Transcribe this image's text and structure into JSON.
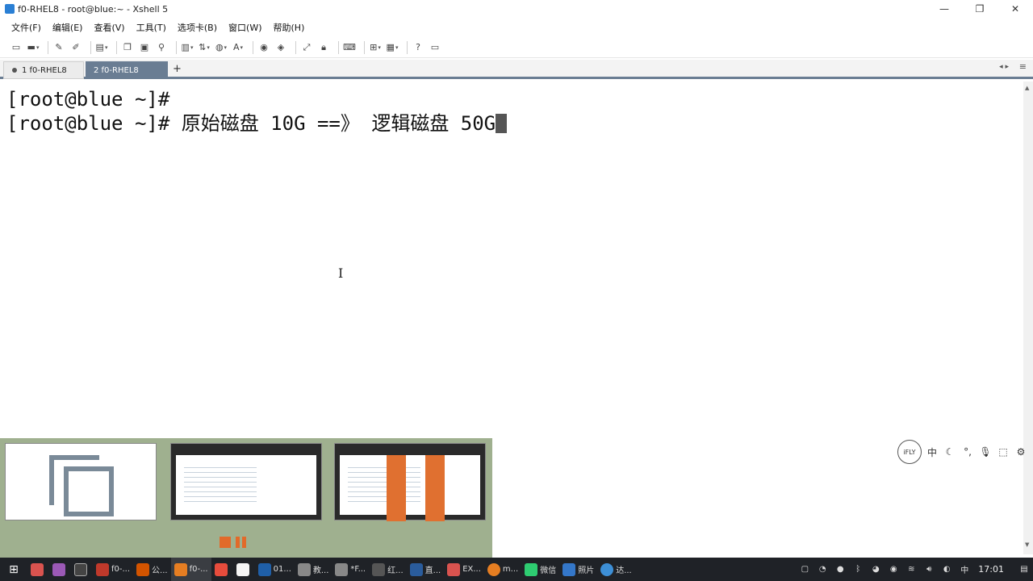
{
  "window": {
    "title": "f0-RHEL8 - root@blue:~ - Xshell 5",
    "minimize": "—",
    "restore": "❐",
    "close": "✕"
  },
  "menu": [
    "文件(F)",
    "编辑(E)",
    "查看(V)",
    "工具(T)",
    "选项卡(B)",
    "窗口(W)",
    "帮助(H)"
  ],
  "tabs": [
    {
      "label": "1 f0-RHEL8",
      "active": false
    },
    {
      "label": "2 f0-RHEL8",
      "active": true
    }
  ],
  "tab_add": "+",
  "terminal": {
    "line1": "[root@blue ~]#",
    "line2": "[root@blue ~]# 原始磁盘 10G ==》 逻辑磁盘 50G"
  },
  "ime": {
    "logo": "iFLY",
    "mode": "中"
  },
  "taskbar": {
    "items": [
      {
        "label": "f0-...",
        "color": "#c0392b"
      },
      {
        "label": "公...",
        "color": "#d35400"
      },
      {
        "label": "f0-...",
        "color": "#e67e22",
        "active": true
      },
      {
        "label": "01...",
        "color": "#1f5fa8"
      },
      {
        "label": "教...",
        "color": "#888888"
      },
      {
        "label": "*F...",
        "color": "#888888"
      },
      {
        "label": "红...",
        "color": "#555555"
      },
      {
        "label": "直...",
        "color": "#2a5c9c"
      },
      {
        "label": "EX...",
        "color": "#d9534f"
      },
      {
        "label": "m...",
        "color": "#e67e22"
      },
      {
        "label": "微信",
        "color": "#2ecc71"
      },
      {
        "label": "照片",
        "color": "#3477c9"
      },
      {
        "label": "达...",
        "color": "#3d8fd6"
      }
    ],
    "clock": "17:01"
  },
  "colors": {
    "tab_active": "#6a7d93",
    "taskbar": "#1f2227",
    "thumb_panel": "#9fb08f",
    "accent_orange": "#e07030"
  }
}
